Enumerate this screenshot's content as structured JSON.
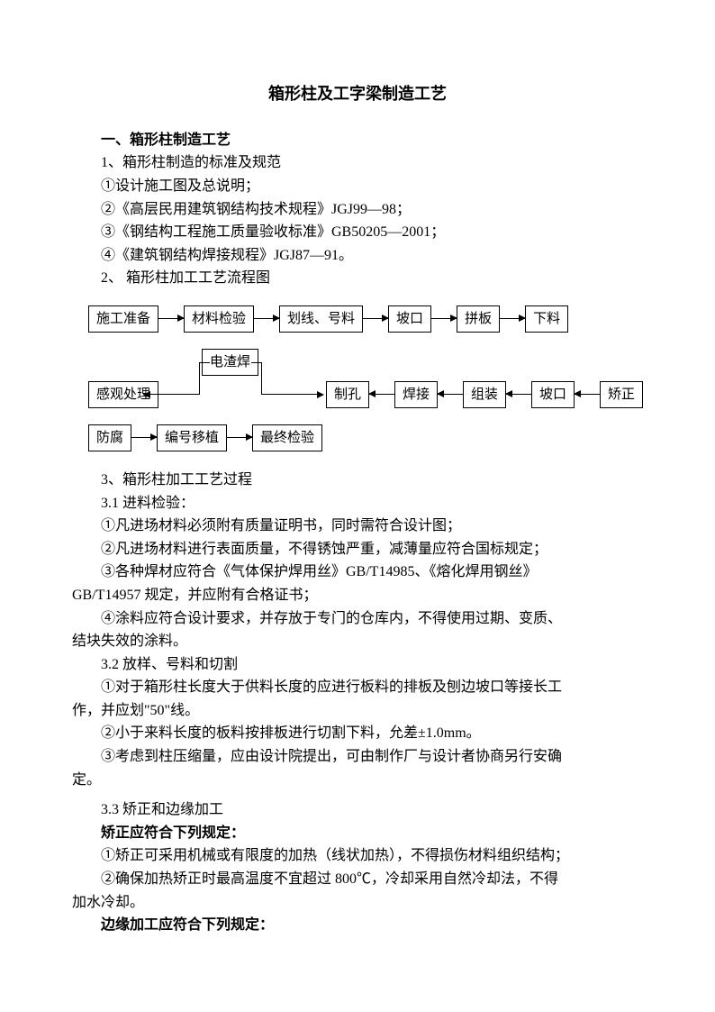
{
  "title": "箱形柱及工字梁制造工艺",
  "s1_heading": "一、箱形柱制造工艺",
  "p1": "1、箱形柱制造的标准及规范",
  "p2": "①设计施工图及总说明；",
  "p3": "②《高层民用建筑钢结构技术规程》JGJ99—98；",
  "p4": "③《钢结构工程施工质量验收标准》GB50205—2001；",
  "p5": "④《建筑钢结构焊接规程》JGJ87—91。",
  "p6": "2、 箱形柱加工工艺流程图",
  "flow": {
    "r1": [
      "施工准备",
      "材料检验",
      "划线、号料",
      "坡口",
      "拼板",
      "下料"
    ],
    "r2top": "电渣焊",
    "r2": [
      "感观处理",
      "制孔",
      "焊接",
      "组装",
      "坡口",
      "矫正"
    ],
    "r3": [
      "防腐",
      "编号移植",
      "最终检验"
    ]
  },
  "p7": "3、箱形柱加工工艺过程",
  "p8": "3.1 进料检验：",
  "p9": "①凡进场材料必须附有质量证明书，同时需符合设计图；",
  "p10": "②凡进场材料进行表面质量，不得锈蚀严重，减薄量应符合国标规定；",
  "p11": "③各种焊材应符合《气体保护焊用丝》GB/T14985、《熔化焊用钢丝》GB/T14957 规定，并应附有合格证书；",
  "p11a": "③各种焊材应符合《气体保护焊用丝》GB/T14985、《熔化焊用钢丝》",
  "p11b": "GB/T14957 规定，并应附有合格证书；",
  "p12a": "④涂料应符合设计要求，并存放于专门的仓库内，不得使用过期、变质、",
  "p12b": "结块失效的涂料。",
  "p13": "3.2 放样、号料和切割",
  "p14a": "①对于箱形柱长度大于供料长度的应进行板料的排板及刨边坡口等接长工",
  "p14b": "作，并应划\"50\"线。",
  "p15": "②小于来料长度的板料按排板进行切割下料，允差±1.0mm。",
  "p16a": "③考虑到柱压缩量，应由设计院提出，可由制作厂与设计者协商另行安确",
  "p16b": "定。",
  "p17": "3.3 矫正和边缘加工",
  "p18": "矫正应符合下列规定：",
  "p19": "①矫正可采用机械或有限度的加热（线状加热），不得损伤材料组织结构；",
  "p20a": "②确保加热矫正时最高温度不宜超过 800℃，冷却采用自然冷却法，不得",
  "p20b": "加水冷却。",
  "p21": "边缘加工应符合下列规定："
}
